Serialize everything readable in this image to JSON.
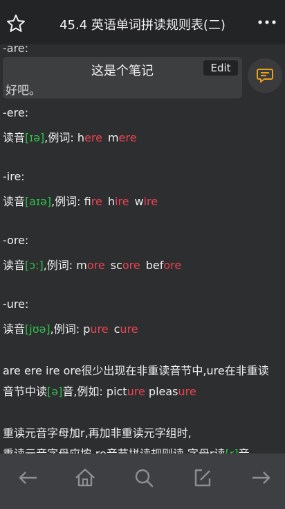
{
  "header": {
    "title": "45.4 英语单词拼读规则表(二)",
    "star_icon": "star-outline-icon",
    "more_icon": "more-dots-icon"
  },
  "content": {
    "cutoff_text": "-are:",
    "note": {
      "title": "这是个笔记",
      "edit_label": "Edit",
      "body": "好吧。"
    },
    "sections": [
      {
        "heading": "-ere:",
        "prefix": "读音",
        "ipa": "[ɪə]",
        "example_label": ",例词: ",
        "words": [
          {
            "black": "h",
            "red": "ere"
          },
          {
            "black": "m",
            "red": "ere"
          }
        ]
      },
      {
        "heading": "-ire:",
        "prefix": "读音",
        "ipa": "[aɪə]",
        "example_label": ",例词: ",
        "words": [
          {
            "black": "f",
            "red": "ire"
          },
          {
            "black": "h",
            "red": "ire"
          },
          {
            "black": "w",
            "red": "ire"
          }
        ]
      },
      {
        "heading": "-ore:",
        "prefix": "读音",
        "ipa": "[ɔ:]",
        "example_label": ",例词: ",
        "words": [
          {
            "black": "m",
            "red": "ore"
          },
          {
            "black": "sc",
            "red": "ore"
          },
          {
            "black": "bef",
            "red": "ore"
          }
        ]
      },
      {
        "heading": "-ure:",
        "prefix": "读音",
        "ipa": "[jʊə]",
        "example_label": ",例词: ",
        "words": [
          {
            "black": "p",
            "red": "ure"
          },
          {
            "black": "c",
            "red": "ure"
          }
        ]
      }
    ],
    "paragraph1": {
      "line1": "are ere ire ore很少出现在非重读音节中,ure在非重读",
      "line2_a": "音节中读",
      "line2_ipa": "[ə]",
      "line2_b": "音,例如: pict",
      "word1_red": "ure",
      "line2_space": " ",
      "word2_black": "pleas",
      "word2_red": "ure"
    },
    "paragraph2": {
      "line1": "重读元音字母加r,再加非重读元字组时,",
      "line2_a": "重读元音字母应按-re音节拼读规则读,字母r读",
      "line2_ipa": "[r]",
      "line2_b": "音 。"
    },
    "chat_icon": "chat-bubble-icon"
  },
  "bottom_nav": {
    "icons": [
      "arrow-left-icon",
      "home-icon",
      "search-icon",
      "edit-icon",
      "arrow-right-icon"
    ]
  },
  "colors": {
    "accent_orange": "#e8a21a",
    "ipa_green": "#2fc24a",
    "highlight_red": "#ec4352",
    "background": "#2d2e30"
  }
}
